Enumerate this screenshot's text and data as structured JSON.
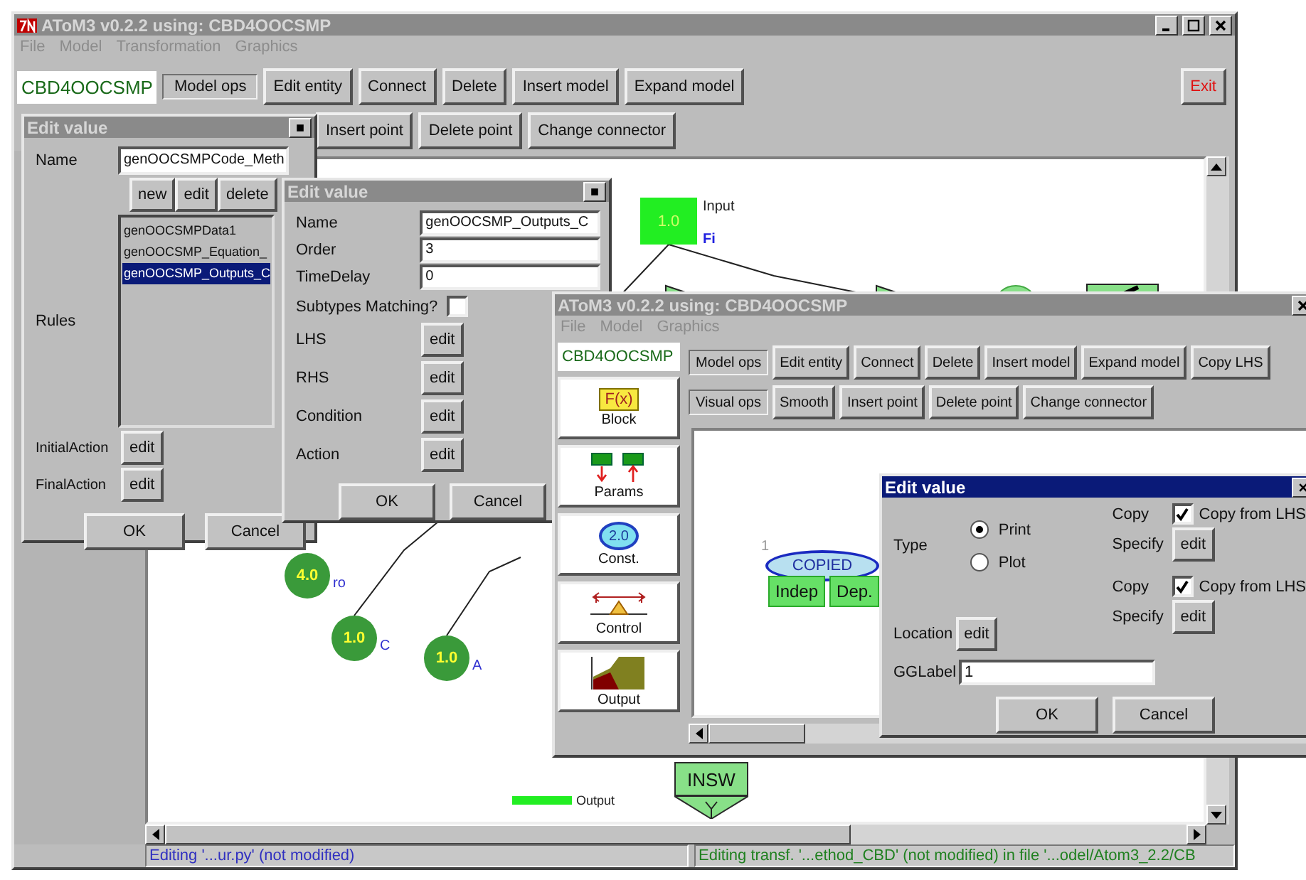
{
  "main_window": {
    "title": "AToM3 v0.2.2 using: CBD4OOCSMP",
    "menu": [
      "File",
      "Model",
      "Transformation",
      "Graphics"
    ],
    "formalism": "CBD4OOCSMP",
    "toolbar_row1": [
      "Model ops",
      "Edit entity",
      "Connect",
      "Delete",
      "Insert model",
      "Expand model"
    ],
    "exit_button": "Exit",
    "toolbar_row2": [
      "Insert point",
      "Delete point",
      "Change connector"
    ],
    "canvas_nodes": [
      {
        "kind": "square",
        "value": "1.0",
        "label": "Input",
        "sublabel": "Fi"
      },
      {
        "kind": "circle",
        "value": "4.0",
        "label": "ro"
      },
      {
        "kind": "circle",
        "value": "1.0",
        "label": "C"
      },
      {
        "kind": "circle",
        "value": "1.0",
        "label": "A"
      },
      {
        "kind": "switch",
        "value": "INSW"
      },
      {
        "kind": "bar",
        "label": "Output"
      }
    ],
    "status_left": "Editing '...ur.py' (not modified)",
    "status_right": "Editing transf. '...ethod_CBD' (not modified) in file '...odel/Atom3_2.2/CB"
  },
  "rules_dialog": {
    "title": "Edit value",
    "name_label": "Name",
    "name_value": "genOOCSMPCode_Meth",
    "list_buttons": [
      "new",
      "edit",
      "delete"
    ],
    "rules_label": "Rules",
    "rules": [
      {
        "text": "genOOCSMPData1",
        "selected": false
      },
      {
        "text": "genOOCSMP_Equation_",
        "selected": false
      },
      {
        "text": "genOOCSMP_Outputs_C",
        "selected": true
      }
    ],
    "actions": [
      {
        "label": "InitialAction",
        "button": "edit"
      },
      {
        "label": "FinalAction",
        "button": "edit"
      }
    ],
    "buttons": [
      "OK",
      "Cancel"
    ]
  },
  "transformation_dialog": {
    "title": "Edit value",
    "fields": [
      {
        "label": "Name",
        "value": "genOOCSMP_Outputs_C"
      },
      {
        "label": "Order",
        "value": "3"
      },
      {
        "label": "TimeDelay",
        "value": "0"
      }
    ],
    "subtypes": {
      "label": "Subtypes Matching?",
      "checked": false
    },
    "edits": [
      {
        "label": "LHS",
        "button": "edit"
      },
      {
        "label": "RHS",
        "button": "edit"
      },
      {
        "label": "Condition",
        "button": "edit"
      },
      {
        "label": "Action",
        "button": "edit"
      }
    ],
    "buttons": [
      "OK",
      "Cancel"
    ]
  },
  "lhs_window": {
    "title": "AToM3 v0.2.2 using: CBD4OOCSMP",
    "menu": [
      "File",
      "Model",
      "Graphics"
    ],
    "formalism": "CBD4OOCSMP",
    "row1_group": "Model ops",
    "toolbar_row1": [
      "Edit entity",
      "Connect",
      "Delete",
      "Insert model",
      "Expand model",
      "Copy LHS"
    ],
    "row2_group": "Visual ops",
    "toolbar_row2": [
      "Smooth",
      "Insert point",
      "Delete point",
      "Change connector"
    ],
    "palette": [
      {
        "kind": "block",
        "icon_text": "F(x)",
        "label": "Block"
      },
      {
        "kind": "params",
        "label": "Params"
      },
      {
        "kind": "const",
        "icon_text": "2.0",
        "label": "Const."
      },
      {
        "kind": "control",
        "label": "Control"
      },
      {
        "kind": "output",
        "label": "Output"
      }
    ],
    "canvas": {
      "number": "1",
      "tag": "COPIED",
      "ports": [
        "Indep",
        "Dep."
      ]
    }
  },
  "graphics_dialog": {
    "title": "Edit value",
    "type_label": "Type",
    "type_options": [
      {
        "label": "Print",
        "selected": true
      },
      {
        "label": "Plot",
        "selected": false
      }
    ],
    "copy_rows": [
      {
        "copy_label": "Copy",
        "checkbox_label": "Copy from LHS",
        "checked": true,
        "specify_label": "Specify",
        "button": "edit"
      },
      {
        "copy_label": "Copy",
        "checkbox_label": "Copy from LHS",
        "checked": true,
        "specify_label": "Specify",
        "button": "edit"
      }
    ],
    "location_label": "Location",
    "location_button": "edit",
    "gglabel_label": "GGLabel",
    "gglabel_value": "1",
    "buttons": [
      "OK",
      "Cancel"
    ]
  }
}
